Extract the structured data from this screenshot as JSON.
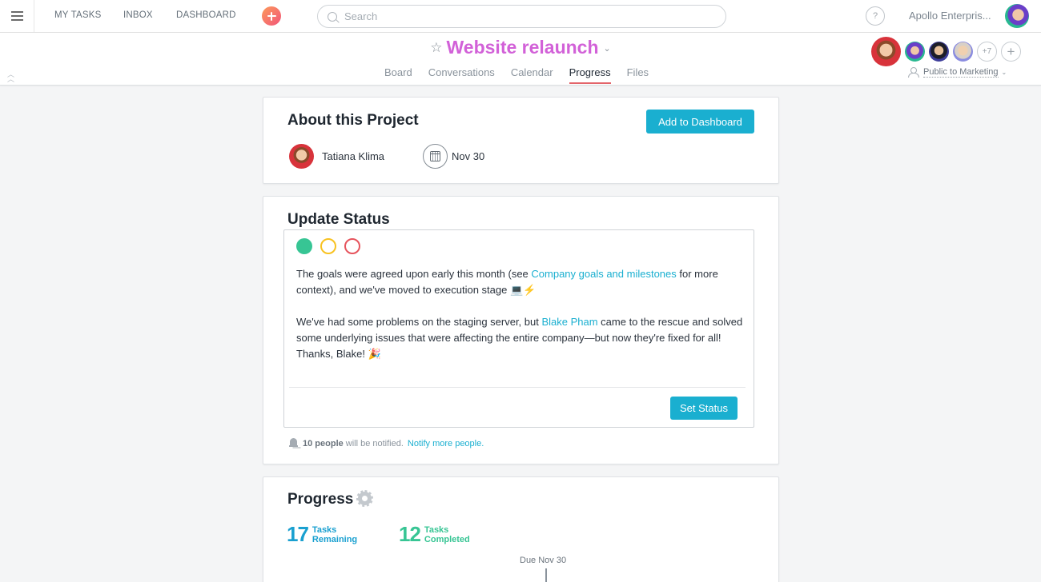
{
  "topbar": {
    "nav": [
      "MY TASKS",
      "INBOX",
      "DASHBOARD"
    ],
    "search_placeholder": "Search",
    "help_label": "?",
    "org_name": "Apollo Enterpris..."
  },
  "project": {
    "title": "Website relaunch",
    "tabs": [
      {
        "label": "Board",
        "active": false
      },
      {
        "label": "Conversations",
        "active": false
      },
      {
        "label": "Calendar",
        "active": false
      },
      {
        "label": "Progress",
        "active": true
      },
      {
        "label": "Files",
        "active": false
      }
    ],
    "members_more": "+7",
    "privacy": "Public to Marketing"
  },
  "about": {
    "title": "About this Project",
    "add_dashboard_label": "Add to Dashboard",
    "owner": "Tatiana Klima",
    "due_date": "Nov 30"
  },
  "update_status": {
    "title": "Update Status",
    "status_options": [
      {
        "name": "green",
        "color": "#37c594",
        "selected": true
      },
      {
        "name": "yellow",
        "color": "#f8c221",
        "selected": false
      },
      {
        "name": "red",
        "color": "#e6545d",
        "selected": false
      }
    ],
    "para1_pre": "The goals were agreed upon early this month (see ",
    "para1_link": "Company goals and milestones",
    "para1_post": " for more context), and we've moved to execution stage 💻⚡",
    "para2_pre": "We've had some problems on the staging server, but ",
    "para2_link": "Blake Pham",
    "para2_post": " came to the rescue and solved some underlying issues that were affecting the entire company—but now they're fixed for all! Thanks, Blake! 🎉",
    "set_status_label": "Set Status",
    "notify_count": "10 people",
    "notify_text": "will be notified.",
    "notify_link": "Notify more people."
  },
  "progress": {
    "title": "Progress",
    "remaining_count": "17",
    "remaining_label_1": "Tasks",
    "remaining_label_2": "Remaining",
    "completed_count": "12",
    "completed_label_1": "Tasks",
    "completed_label_2": "Completed",
    "due_marker": "Due Nov 30"
  },
  "colors": {
    "accent": "#1aafd0",
    "title": "#d261d8",
    "tab_underline": "#e3646a",
    "completed": "#37c594"
  }
}
